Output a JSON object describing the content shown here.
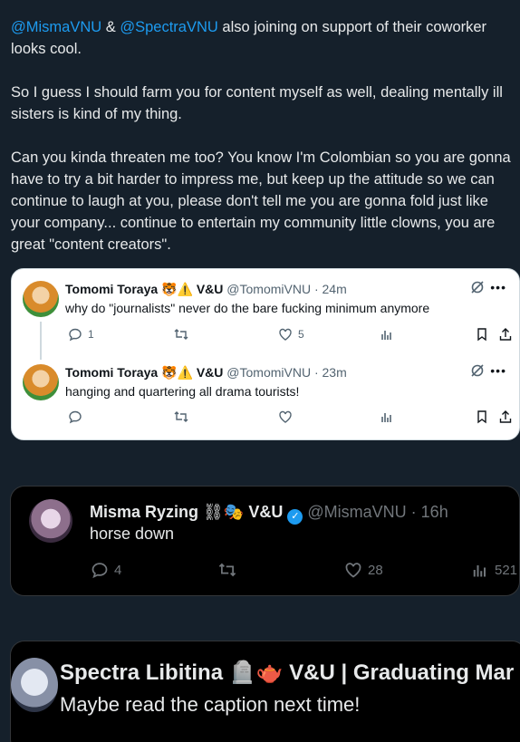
{
  "post": {
    "mention1": "@MismaVNU",
    "amp": " & ",
    "mention2": "@SpectraVNU",
    "line1_rest": " also joining on support of their coworker looks cool.",
    "para2": "So I guess I should farm you for content myself as well, dealing mentally ill sisters is kind of my thing.",
    "para3": "Can you kinda threaten me too? You know I'm Colombian so you are gonna have to try a bit harder to impress me, but keep up the attitude so we can continue to laugh at you, please don't tell me you are gonna fold just like your company... continue to entertain my community little clowns, you are great \"content creators\"."
  },
  "light_card": {
    "tweets": [
      {
        "name": "Tomomi Toraya",
        "emoji": "🐯⚠️",
        "affil": "V&U",
        "handle": "@TomomiVNU",
        "time": "· 24m",
        "text": "why do \"journalists\" never do the bare fucking minimum anymore",
        "replies": "1",
        "retweets": "",
        "likes": "5"
      },
      {
        "name": "Tomomi Toraya",
        "emoji": "🐯⚠️",
        "affil": "V&U",
        "handle": "@TomomiVNU",
        "time": "· 23m",
        "text": "hanging and quartering all drama tourists!",
        "replies": "",
        "retweets": "",
        "likes": ""
      }
    ]
  },
  "dark_card1": {
    "name": "Misma Ryzing",
    "emoji": "⛓🎭",
    "affil": "V&U",
    "handle": "@MismaVNU",
    "time": "· 16h",
    "text": "horse down",
    "replies": "4",
    "likes": "28",
    "views": "521"
  },
  "dark_card2": {
    "name": "Spectra Libitina",
    "emoji": "🪦🫖",
    "affil": "V&U | Graduating Mar",
    "text": "Maybe read the caption next time!"
  },
  "colors": {
    "background": "#15202b",
    "link": "#1d9bf0",
    "verified": "#1d9bf0"
  }
}
